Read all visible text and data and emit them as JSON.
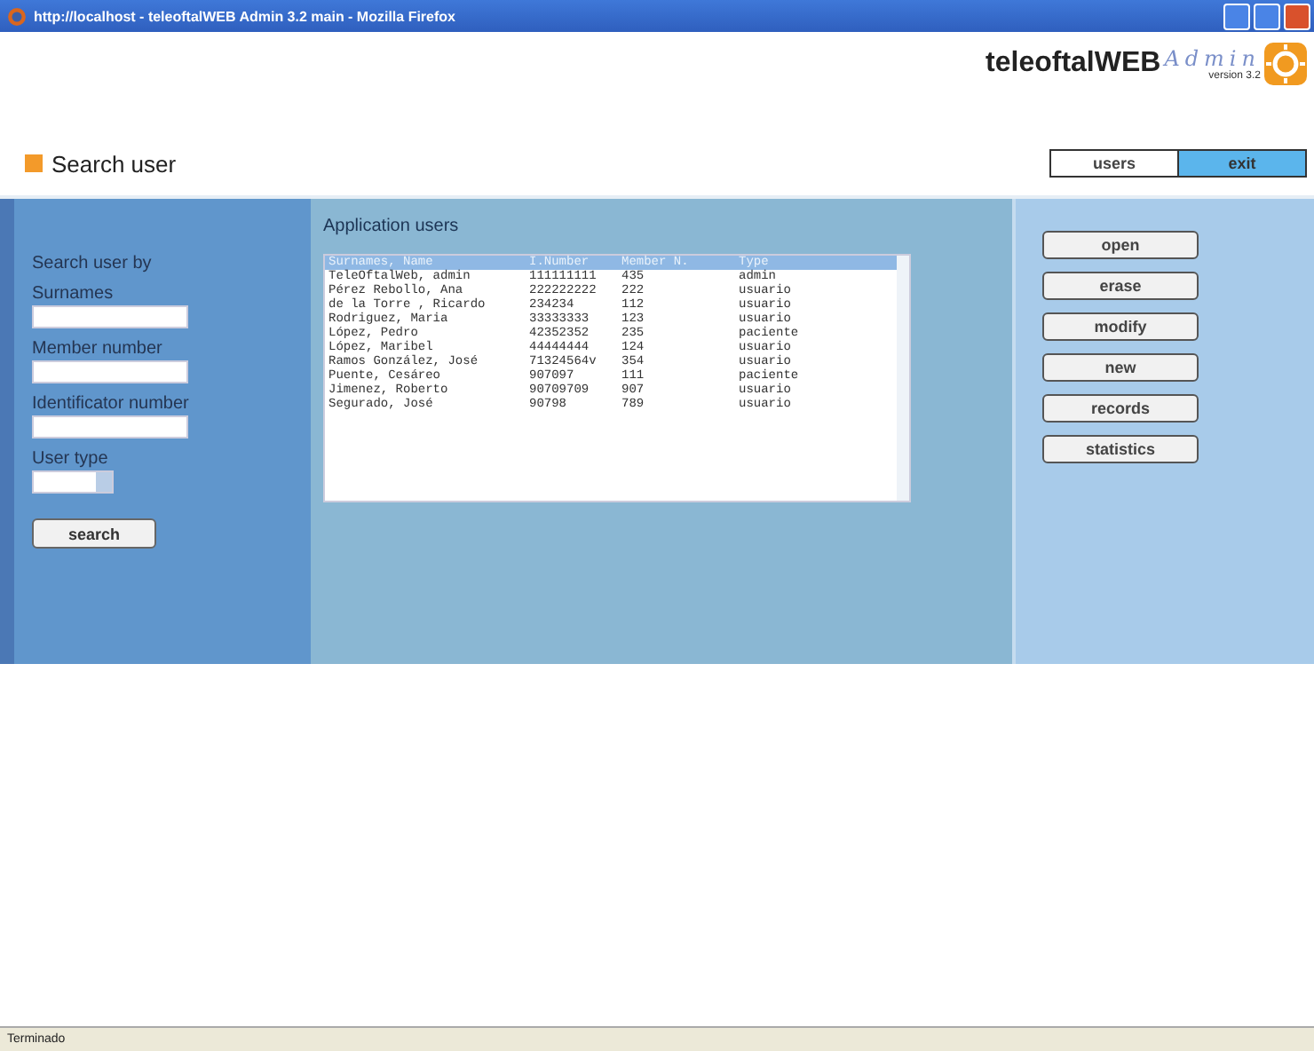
{
  "window": {
    "title": "http://localhost - teleoftalWEB Admin 3.2 main - Mozilla Firefox"
  },
  "logo": {
    "name": "teleoftalWEB",
    "script": "Admin",
    "version": "version 3.2"
  },
  "page_title": "Search user",
  "nav_tabs": [
    {
      "label": "users",
      "selected": false
    },
    {
      "label": "exit",
      "selected": true
    }
  ],
  "search_panel": {
    "heading": "Search user by",
    "fields": [
      {
        "label": "Surnames",
        "kind": "text"
      },
      {
        "label": "Member number",
        "kind": "text"
      },
      {
        "label": "Identificator number",
        "kind": "text"
      },
      {
        "label": "User type",
        "kind": "select"
      }
    ],
    "button": "search"
  },
  "users_panel": {
    "heading": "Application users",
    "columns": [
      "Surnames, Name",
      "I.Number",
      "Member N.",
      "Type"
    ],
    "rows": [
      [
        "TeleOftalWeb, admin",
        "111111111",
        "435",
        "admin"
      ],
      [
        "Pérez Rebollo, Ana",
        "222222222",
        "222",
        "usuario"
      ],
      [
        "de la Torre , Ricardo",
        "234234",
        "112",
        "usuario"
      ],
      [
        "Rodriguez, Maria",
        "33333333",
        "123",
        "usuario"
      ],
      [
        "López, Pedro",
        "42352352",
        "235",
        "paciente"
      ],
      [
        "López, Maribel",
        "44444444",
        "124",
        "usuario"
      ],
      [
        "Ramos González, José",
        "71324564v",
        "354",
        "usuario"
      ],
      [
        "Puente, Cesáreo",
        "907097",
        "111",
        "paciente"
      ],
      [
        "Jimenez, Roberto",
        "90709709",
        "907",
        "usuario"
      ],
      [
        "Segurado, José",
        "90798",
        "789",
        "usuario"
      ]
    ]
  },
  "actions": [
    "open",
    "erase",
    "modify",
    "new",
    "records",
    "statistics"
  ],
  "status_bar": "Terminado"
}
